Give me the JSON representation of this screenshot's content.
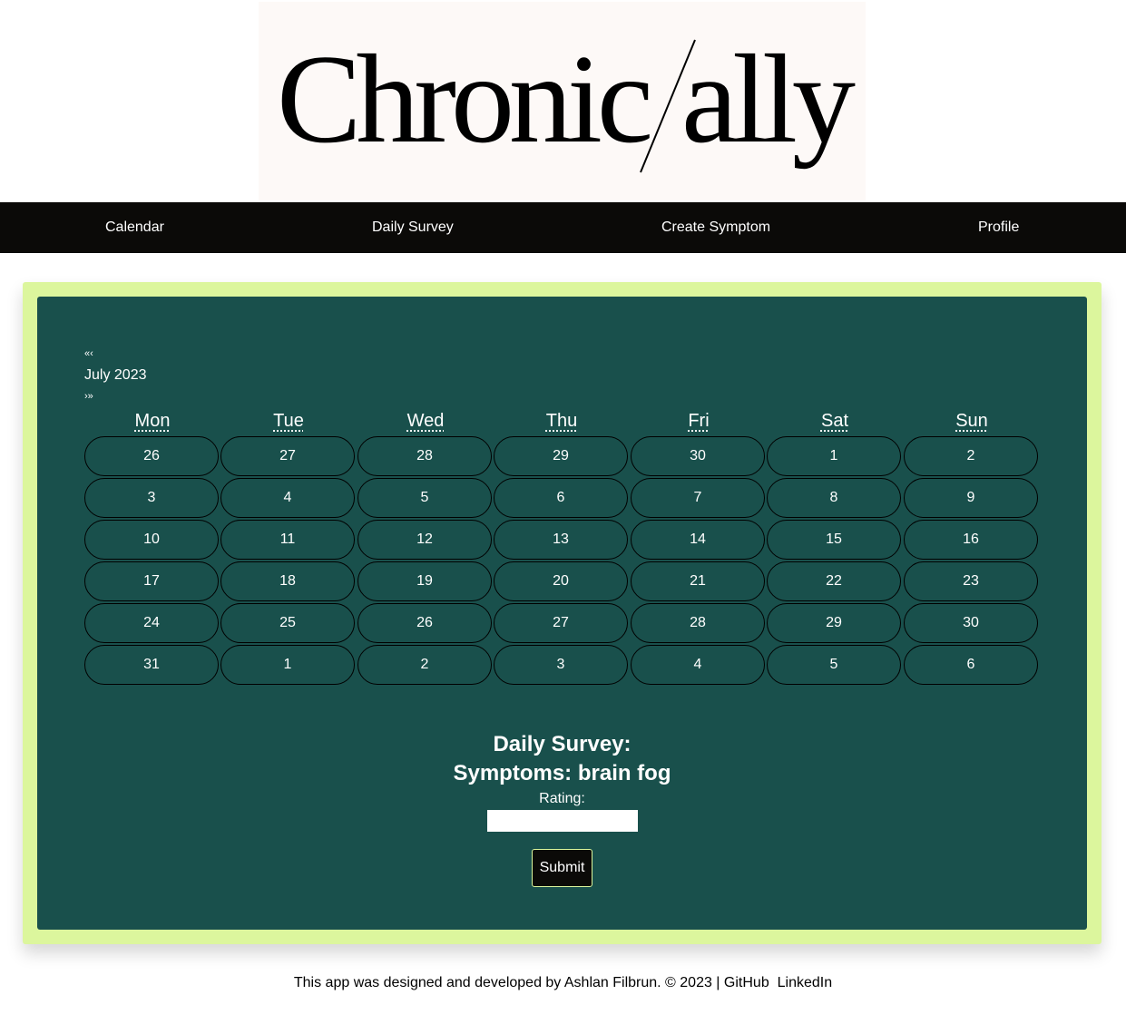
{
  "logo": {
    "text_left": "Chronic",
    "slash": "/",
    "text_right": "ally"
  },
  "nav": {
    "items": [
      {
        "label": "Calendar"
      },
      {
        "label": "Daily Survey"
      },
      {
        "label": "Create Symptom"
      },
      {
        "label": "Profile"
      }
    ]
  },
  "calendar": {
    "prev_year": "«",
    "prev_month": "‹",
    "month_label": "July 2023",
    "next_month": "›",
    "next_year": "»",
    "weekdays": [
      "Mon",
      "Tue",
      "Wed",
      "Thu",
      "Fri",
      "Sat",
      "Sun"
    ],
    "days": [
      "26",
      "27",
      "28",
      "29",
      "30",
      "1",
      "2",
      "3",
      "4",
      "5",
      "6",
      "7",
      "8",
      "9",
      "10",
      "11",
      "12",
      "13",
      "14",
      "15",
      "16",
      "17",
      "18",
      "19",
      "20",
      "21",
      "22",
      "23",
      "24",
      "25",
      "26",
      "27",
      "28",
      "29",
      "30",
      "31",
      "1",
      "2",
      "3",
      "4",
      "5",
      "6"
    ]
  },
  "survey": {
    "heading": "Daily Survey:",
    "symptom": "Symptoms: brain fog",
    "rating_label": "Rating:",
    "rating_value": "",
    "submit_label": "Submit"
  },
  "footer": {
    "text": "This app was designed and developed by Ashlan Filbrun. © 2023 |",
    "github_label": "GitHub",
    "linkedin_label": "LinkedIn"
  },
  "colors": {
    "nav_bg": "#0b0a08",
    "outer_bg": "#dcf69d",
    "panel_bg": "#19504c",
    "logo_bg": "#fdf9f7"
  }
}
